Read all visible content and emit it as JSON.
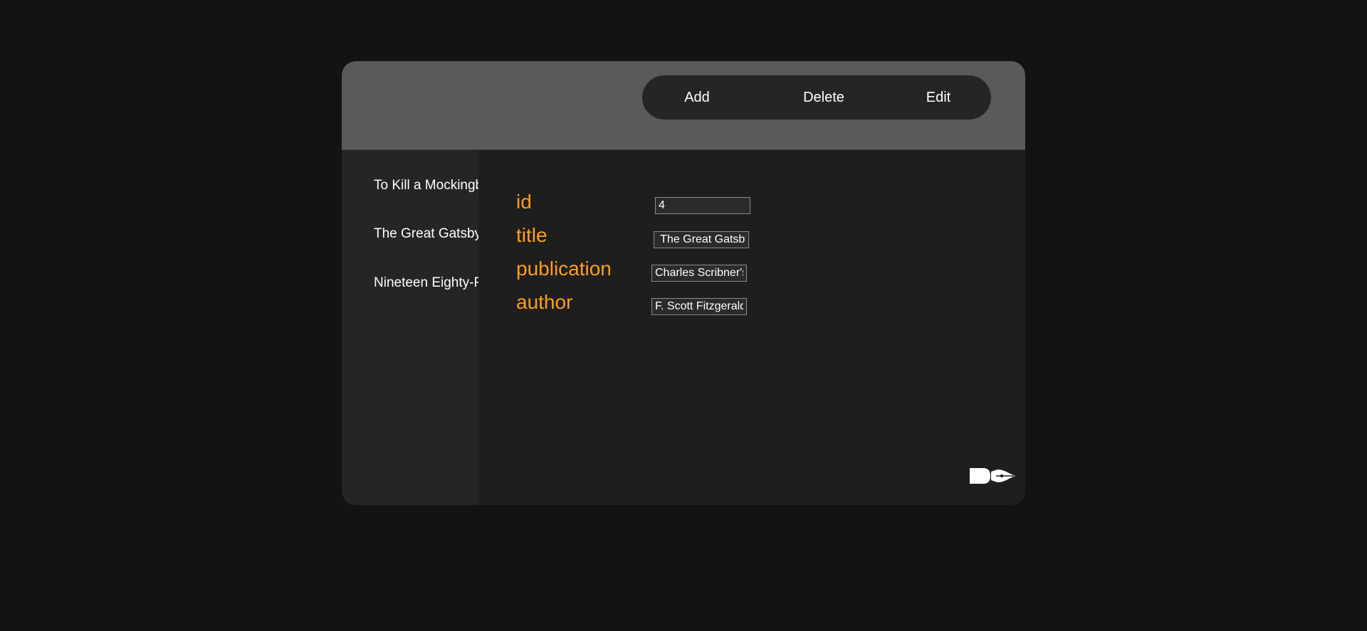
{
  "toolbar": {
    "add_label": "Add",
    "delete_label": "Delete",
    "edit_label": "Edit"
  },
  "sidebar": {
    "items": [
      {
        "label": "To Kill a Mockingbird"
      },
      {
        "label": "The Great Gatsby"
      },
      {
        "label": "Nineteen Eighty-Four"
      }
    ]
  },
  "form": {
    "id": {
      "label": "id",
      "value": "4"
    },
    "title": {
      "label": "title",
      "value": " The Great Gatsby"
    },
    "publication": {
      "label": "publication",
      "value": "Charles Scribner's Sons"
    },
    "author": {
      "label": "author",
      "value": "F. Scott Fitzgerald"
    }
  },
  "colors": {
    "background": "#131313",
    "header": "#5a5a5a",
    "toolbar": "#252525",
    "sidebar": "#252525",
    "main": "#1e1e1e",
    "label_accent": "#ff9f1c",
    "text": "#ffffff"
  },
  "logo": {
    "icon": "pen-nib-logo-icon"
  }
}
